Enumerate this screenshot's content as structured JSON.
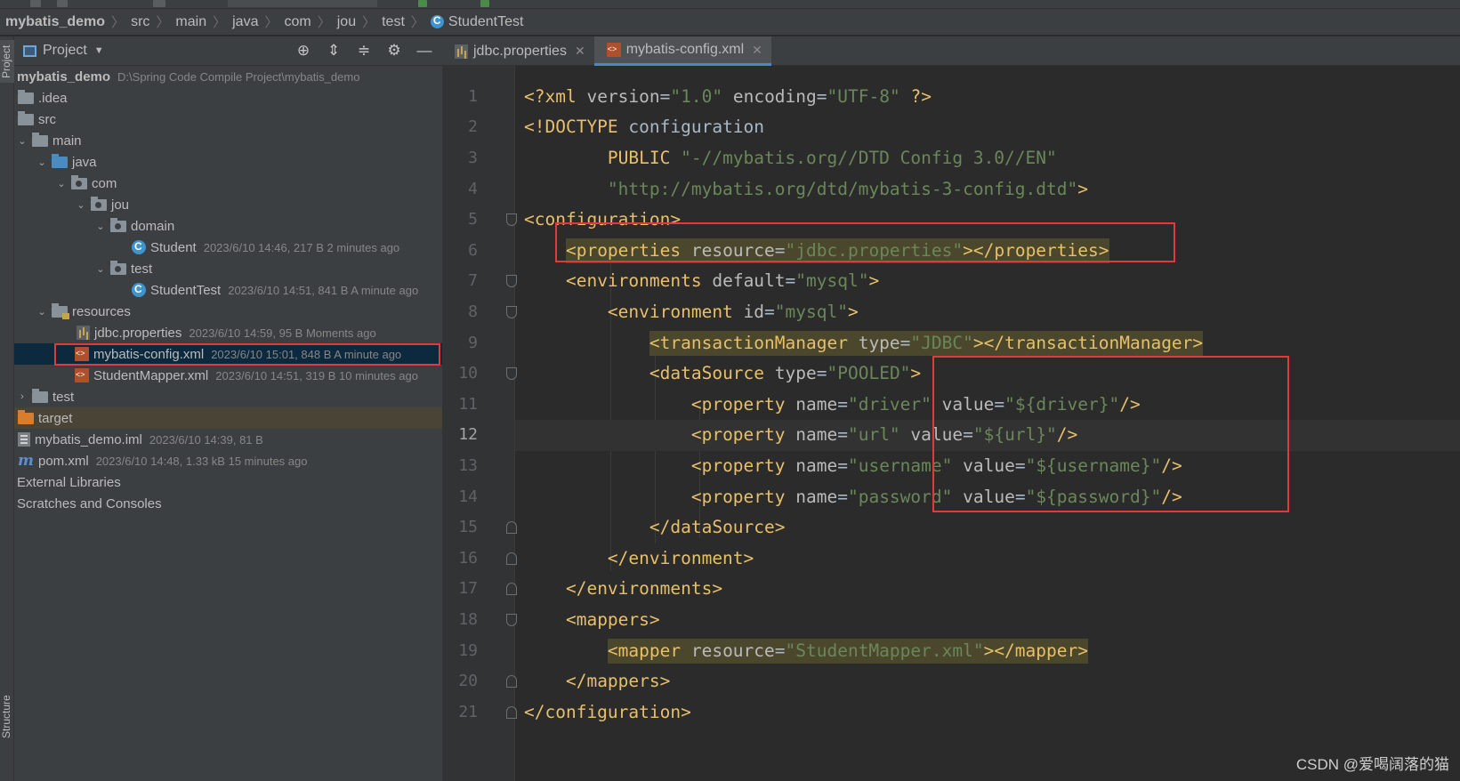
{
  "breadcrumb": [
    "mybatis_demo",
    "src",
    "main",
    "java",
    "com",
    "jou",
    "test",
    "StudentTest"
  ],
  "stripe": {
    "project": "Project",
    "structure": "Structure"
  },
  "project_panel": {
    "title": "Project",
    "tree": [
      {
        "name": "mybatis_demo",
        "meta": "D:\\Spring Code Compile Project\\mybatis_demo"
      },
      {
        "name": ".idea",
        "meta": ""
      },
      {
        "name": "src",
        "meta": ""
      },
      {
        "name": "main",
        "meta": ""
      },
      {
        "name": "java",
        "meta": ""
      },
      {
        "name": "com",
        "meta": ""
      },
      {
        "name": "jou",
        "meta": ""
      },
      {
        "name": "domain",
        "meta": ""
      },
      {
        "name": "Student",
        "meta": "2023/6/10 14:46, 217 B 2 minutes ago"
      },
      {
        "name": "test",
        "meta": ""
      },
      {
        "name": "StudentTest",
        "meta": "2023/6/10 14:51, 841 B A minute ago"
      },
      {
        "name": "resources",
        "meta": ""
      },
      {
        "name": "jdbc.properties",
        "meta": "2023/6/10 14:59, 95 B Moments ago"
      },
      {
        "name": "mybatis-config.xml",
        "meta": "2023/6/10 15:01, 848 B A minute ago"
      },
      {
        "name": "StudentMapper.xml",
        "meta": "2023/6/10 14:51, 319 B 10 minutes ago"
      },
      {
        "name": "test",
        "meta": ""
      },
      {
        "name": "target",
        "meta": ""
      },
      {
        "name": "mybatis_demo.iml",
        "meta": "2023/6/10 14:39, 81 B"
      },
      {
        "name": "pom.xml",
        "meta": "2023/6/10 14:48, 1.33 kB 15 minutes ago"
      },
      {
        "name": "External Libraries",
        "meta": ""
      },
      {
        "name": "Scratches and Consoles",
        "meta": ""
      }
    ]
  },
  "tabs": [
    {
      "label": "jdbc.properties",
      "active": false
    },
    {
      "label": "mybatis-config.xml",
      "active": true
    }
  ],
  "editor": {
    "current_line": 12,
    "lines": [
      {
        "n": "1",
        "indent": "",
        "parts": [
          [
            "tag",
            "<?xml "
          ],
          [
            "attr",
            "version"
          ],
          [
            "plain",
            "="
          ],
          [
            "val",
            "\"1.0\""
          ],
          [
            "plain",
            " "
          ],
          [
            "attr",
            "encoding"
          ],
          [
            "plain",
            "="
          ],
          [
            "val",
            "\"UTF-8\""
          ],
          [
            "plain",
            " "
          ],
          [
            "tag",
            "?>"
          ]
        ]
      },
      {
        "n": "2",
        "indent": "",
        "parts": [
          [
            "tag",
            "<!DOCTYPE "
          ],
          [
            "plain",
            "configuration"
          ]
        ]
      },
      {
        "n": "3",
        "indent": "        ",
        "parts": [
          [
            "tag",
            "PUBLIC "
          ],
          [
            "val",
            "\"-//mybatis.org//DTD Config 3.0//EN\""
          ]
        ]
      },
      {
        "n": "4",
        "indent": "        ",
        "parts": [
          [
            "val",
            "\"http://mybatis.org/dtd/mybatis-3-config.dtd\""
          ],
          [
            "tag",
            ">"
          ]
        ]
      },
      {
        "n": "5",
        "indent": "",
        "parts": [
          [
            "tag",
            "<configuration>"
          ]
        ]
      },
      {
        "n": "6",
        "indent": "    ",
        "hl": true,
        "parts": [
          [
            "tag",
            "<properties "
          ],
          [
            "attr",
            "resource"
          ],
          [
            "plain",
            "="
          ],
          [
            "val",
            "\"jdbc.properties\""
          ],
          [
            "tag",
            "></properties>"
          ]
        ]
      },
      {
        "n": "7",
        "indent": "    ",
        "parts": [
          [
            "tag",
            "<environments "
          ],
          [
            "attr",
            "default"
          ],
          [
            "plain",
            "="
          ],
          [
            "val",
            "\"mysql\""
          ],
          [
            "tag",
            ">"
          ]
        ]
      },
      {
        "n": "8",
        "indent": "        ",
        "parts": [
          [
            "tag",
            "<environment "
          ],
          [
            "attr",
            "id"
          ],
          [
            "plain",
            "="
          ],
          [
            "val",
            "\"mysql\""
          ],
          [
            "tag",
            ">"
          ]
        ]
      },
      {
        "n": "9",
        "indent": "            ",
        "hl": true,
        "parts": [
          [
            "tag",
            "<transactionManager "
          ],
          [
            "attr",
            "type"
          ],
          [
            "plain",
            "="
          ],
          [
            "val",
            "\"JDBC\""
          ],
          [
            "tag",
            "></transactionManager>"
          ]
        ]
      },
      {
        "n": "10",
        "indent": "            ",
        "parts": [
          [
            "tag",
            "<dataSource "
          ],
          [
            "attr",
            "type"
          ],
          [
            "plain",
            "="
          ],
          [
            "val",
            "\"POOLED\""
          ],
          [
            "tag",
            ">"
          ]
        ]
      },
      {
        "n": "11",
        "indent": "                ",
        "parts": [
          [
            "tag",
            "<property "
          ],
          [
            "attr",
            "name"
          ],
          [
            "plain",
            "="
          ],
          [
            "val",
            "\"driver\""
          ],
          [
            "plain",
            " "
          ],
          [
            "attr",
            "value"
          ],
          [
            "plain",
            "="
          ],
          [
            "val",
            "\"${driver}\""
          ],
          [
            "tag",
            "/>"
          ]
        ]
      },
      {
        "n": "12",
        "indent": "                ",
        "parts": [
          [
            "tag",
            "<property "
          ],
          [
            "attr",
            "name"
          ],
          [
            "plain",
            "="
          ],
          [
            "val",
            "\"url\""
          ],
          [
            "plain",
            " "
          ],
          [
            "attr",
            "value"
          ],
          [
            "plain",
            "="
          ],
          [
            "val",
            "\"${url}\""
          ],
          [
            "tag",
            "/>"
          ]
        ]
      },
      {
        "n": "13",
        "indent": "                ",
        "parts": [
          [
            "tag",
            "<property "
          ],
          [
            "attr",
            "name"
          ],
          [
            "plain",
            "="
          ],
          [
            "val",
            "\"username\""
          ],
          [
            "plain",
            " "
          ],
          [
            "attr",
            "value"
          ],
          [
            "plain",
            "="
          ],
          [
            "val",
            "\"${username}\""
          ],
          [
            "tag",
            "/>"
          ]
        ]
      },
      {
        "n": "14",
        "indent": "                ",
        "parts": [
          [
            "tag",
            "<property "
          ],
          [
            "attr",
            "name"
          ],
          [
            "plain",
            "="
          ],
          [
            "val",
            "\"password\""
          ],
          [
            "plain",
            " "
          ],
          [
            "attr",
            "value"
          ],
          [
            "plain",
            "="
          ],
          [
            "val",
            "\"${password}\""
          ],
          [
            "tag",
            "/>"
          ]
        ]
      },
      {
        "n": "15",
        "indent": "            ",
        "parts": [
          [
            "tag",
            "</dataSource>"
          ]
        ]
      },
      {
        "n": "16",
        "indent": "        ",
        "parts": [
          [
            "tag",
            "</environment>"
          ]
        ]
      },
      {
        "n": "17",
        "indent": "    ",
        "parts": [
          [
            "tag",
            "</environments>"
          ]
        ]
      },
      {
        "n": "18",
        "indent": "    ",
        "parts": [
          [
            "tag",
            "<mappers>"
          ]
        ]
      },
      {
        "n": "19",
        "indent": "        ",
        "hl": true,
        "parts": [
          [
            "tag",
            "<mapper "
          ],
          [
            "attr",
            "resource"
          ],
          [
            "plain",
            "="
          ],
          [
            "val",
            "\"StudentMapper.xml\""
          ],
          [
            "tag",
            "></mapper>"
          ]
        ]
      },
      {
        "n": "20",
        "indent": "    ",
        "parts": [
          [
            "tag",
            "</mappers>"
          ]
        ]
      },
      {
        "n": "21",
        "indent": "",
        "parts": [
          [
            "tag",
            "</configuration>"
          ]
        ]
      }
    ]
  },
  "watermark": "CSDN @爱喝阔落的猫",
  "colors": {
    "tag": "#e8bf6a",
    "attr": "#bababa",
    "value": "#6a8759",
    "annotation_box": "#e03a3e",
    "selection": "#0d293e"
  }
}
